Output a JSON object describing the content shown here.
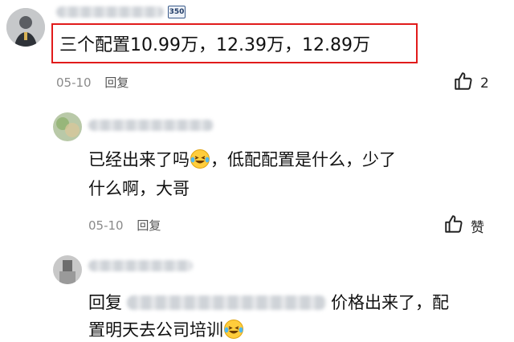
{
  "comment1": {
    "badge": "350",
    "text": "三个配置10.99万，12.39万，12.89万",
    "date": "05-10",
    "reply_label": "回复",
    "like_count": "2"
  },
  "comment2": {
    "line1": "已经出来了吗",
    "line1_rest": "，低配配置是什么，少了",
    "line2": "什么啊，大哥",
    "date": "05-10",
    "reply_label": "回复",
    "like_label": "赞"
  },
  "comment3": {
    "reply_prefix": "回复",
    "line1_rest": "价格出来了，配",
    "line2": "置明天去公司培训"
  }
}
